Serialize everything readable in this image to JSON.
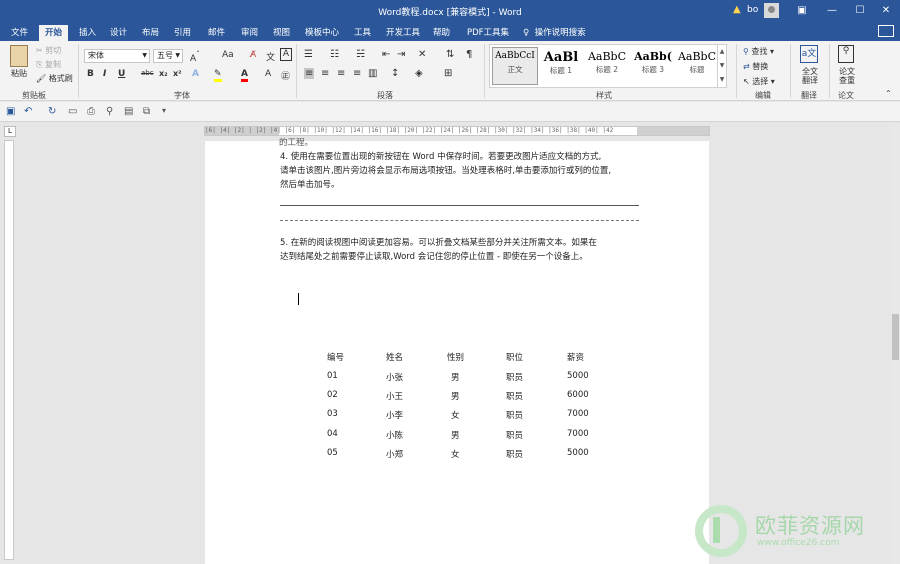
{
  "titlebar": {
    "title": "Word教程.docx [兼容模式] - Word",
    "warning_icon": "warning-icon",
    "user": "bo",
    "buttons": [
      "ribbon-display-icon",
      "minimize-icon",
      "maximize-icon",
      "close-icon"
    ]
  },
  "tabs": [
    "文件",
    "开始",
    "插入",
    "设计",
    "布局",
    "引用",
    "邮件",
    "审阅",
    "视图",
    "模板中心",
    "工具",
    "开发工具",
    "帮助",
    "PDF工具集"
  ],
  "active_tab": "开始",
  "tell_me": "操作说明搜索",
  "ribbon": {
    "clipboard": {
      "paste": "粘贴",
      "cut": "剪切",
      "copy": "复制",
      "format_painter": "格式刷",
      "label": "剪贴板"
    },
    "font": {
      "name": "宋体",
      "size": "五号",
      "label": "字体"
    },
    "paragraph": {
      "label": "段落"
    },
    "styles": {
      "label": "样式",
      "items": [
        {
          "sample": "AaBbCcI",
          "name": "正文"
        },
        {
          "sample": "AaBl",
          "name": "标题 1"
        },
        {
          "sample": "AaBbC",
          "name": "标题 2"
        },
        {
          "sample": "AaBb(",
          "name": "标题 3"
        },
        {
          "sample": "AaBbC",
          "name": "标题"
        }
      ]
    },
    "editing": {
      "find": "查找",
      "replace": "替换",
      "select": "选择",
      "label": "编辑"
    },
    "translate": {
      "button": "全文翻译",
      "label": "翻译"
    },
    "paper": {
      "button": "论文查重",
      "label": "论文"
    }
  },
  "document": {
    "top_fragment": "的工程。",
    "para4_lines": [
      "4. 使用在需要位置出现的新按钮在 Word 中保存时间。若要更改图片适应文档的方式,",
      "请单击该图片,图片旁边将会显示布局选项按钮。当处理表格时,单击要添加行或列的位置,",
      "然后单击加号。"
    ],
    "para5_lines": [
      "5. 在新的阅读视图中阅读更加容易。可以折叠文档某些部分并关注所需文本。如果在",
      "达到结尾处之前需要停止读取,Word 会记住您的停止位置 - 即使在另一个设备上。"
    ],
    "table": {
      "headers": [
        "编号",
        "姓名",
        "性别",
        "职位",
        "薪资"
      ],
      "rows": [
        [
          "01",
          "小张",
          "男",
          "职员",
          "5000"
        ],
        [
          "02",
          "小王",
          "男",
          "职员",
          "6000"
        ],
        [
          "03",
          "小李",
          "女",
          "职员",
          "7000"
        ],
        [
          "04",
          "小陈",
          "男",
          "职员",
          "7000"
        ],
        [
          "05",
          "小郑",
          "女",
          "职员",
          "5000"
        ]
      ]
    }
  },
  "ruler_text": "|6| |4| |2| | |2| |4| |6| |8| |10| |12| |14| |16| |18| |20| |22| |24| |26| |28| |30| |32| |34| |36| |38| |40| |42",
  "watermark": {
    "brand": "欧菲资源网",
    "url": "www.office26.com"
  }
}
